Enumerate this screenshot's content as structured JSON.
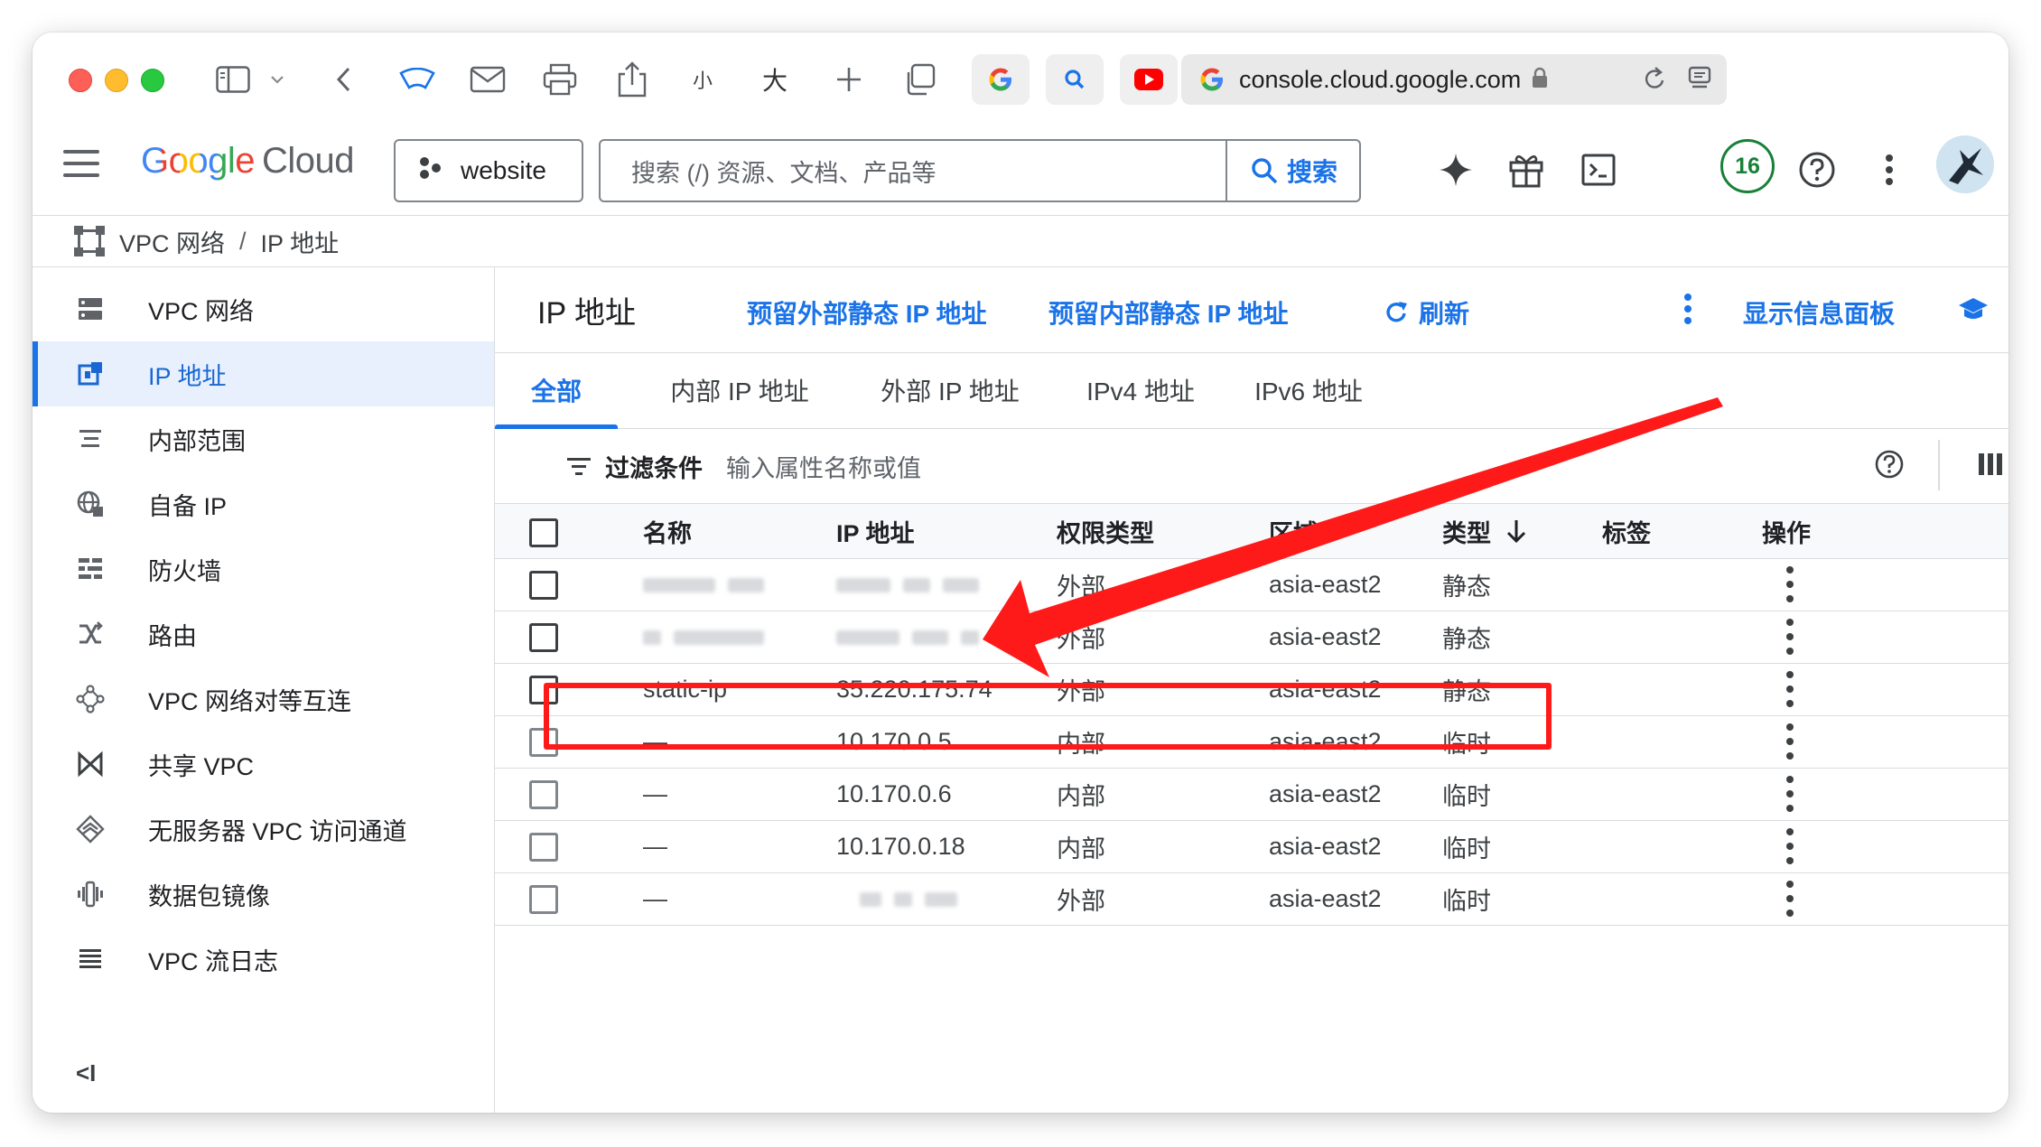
{
  "browser": {
    "address_url": "console.cloud.google.com",
    "zoom_small_label": "小",
    "zoom_large_label": "大"
  },
  "header": {
    "logo_google": "Google",
    "logo_cloud": "Cloud",
    "project_name": "website",
    "search_placeholder": "搜索 (/) 资源、文档、产品等",
    "search_button": "搜索",
    "notification_count": "16"
  },
  "breadcrumb": {
    "items": [
      "VPC 网络",
      "IP 地址"
    ]
  },
  "sidebar": {
    "items": [
      {
        "label": "VPC 网络",
        "icon": "vpc-network-icon"
      },
      {
        "label": "IP 地址",
        "icon": "ip-address-icon",
        "active": true
      },
      {
        "label": "内部范围",
        "icon": "internal-ranges-icon"
      },
      {
        "label": "自备 IP",
        "icon": "byoip-icon"
      },
      {
        "label": "防火墙",
        "icon": "firewall-icon"
      },
      {
        "label": "路由",
        "icon": "routes-icon"
      },
      {
        "label": "VPC 网络对等互连",
        "icon": "peering-icon"
      },
      {
        "label": "共享 VPC",
        "icon": "shared-vpc-icon"
      },
      {
        "label": "无服务器 VPC 访问通道",
        "icon": "serverless-icon"
      },
      {
        "label": "数据包镜像",
        "icon": "packet-mirroring-icon"
      },
      {
        "label": "VPC 流日志",
        "icon": "flow-logs-icon"
      }
    ],
    "collapse_label": "<I"
  },
  "main": {
    "title": "IP 地址",
    "actions": {
      "reserve_external": "预留外部静态 IP 地址",
      "reserve_internal": "预留内部静态 IP 地址",
      "refresh": "刷新",
      "info_panel": "显示信息面板"
    },
    "tabs": [
      "全部",
      "内部 IP 地址",
      "外部 IP 地址",
      "IPv4 地址",
      "IPv6 地址"
    ],
    "filter": {
      "label": "过滤条件",
      "placeholder": "输入属性名称或值"
    },
    "table": {
      "columns": [
        "名称",
        "IP 地址",
        "权限类型",
        "区域",
        "类型",
        "标签",
        "操作"
      ],
      "rows": [
        {
          "name": "",
          "ip": "",
          "access": "外部",
          "region": "asia-east2",
          "type": "静态"
        },
        {
          "name": "",
          "ip": "",
          "access": "外部",
          "region": "asia-east2",
          "type": "静态"
        },
        {
          "name": "static-ip",
          "ip": "35.220.175.74",
          "access": "外部",
          "region": "asia-east2",
          "type": "静态"
        },
        {
          "name": "—",
          "ip": "10.170.0.5",
          "access": "内部",
          "region": "asia-east2",
          "type": "临时"
        },
        {
          "name": "—",
          "ip": "10.170.0.6",
          "access": "内部",
          "region": "asia-east2",
          "type": "临时"
        },
        {
          "name": "—",
          "ip": "10.170.0.18",
          "access": "内部",
          "region": "asia-east2",
          "type": "临时"
        },
        {
          "name": "—",
          "ip": "",
          "access": "外部",
          "region": "asia-east2",
          "type": "临时"
        }
      ]
    }
  },
  "colors": {
    "accent": "#1a73e8",
    "annotation": "#ff1a1a",
    "badge_green": "#188038"
  }
}
